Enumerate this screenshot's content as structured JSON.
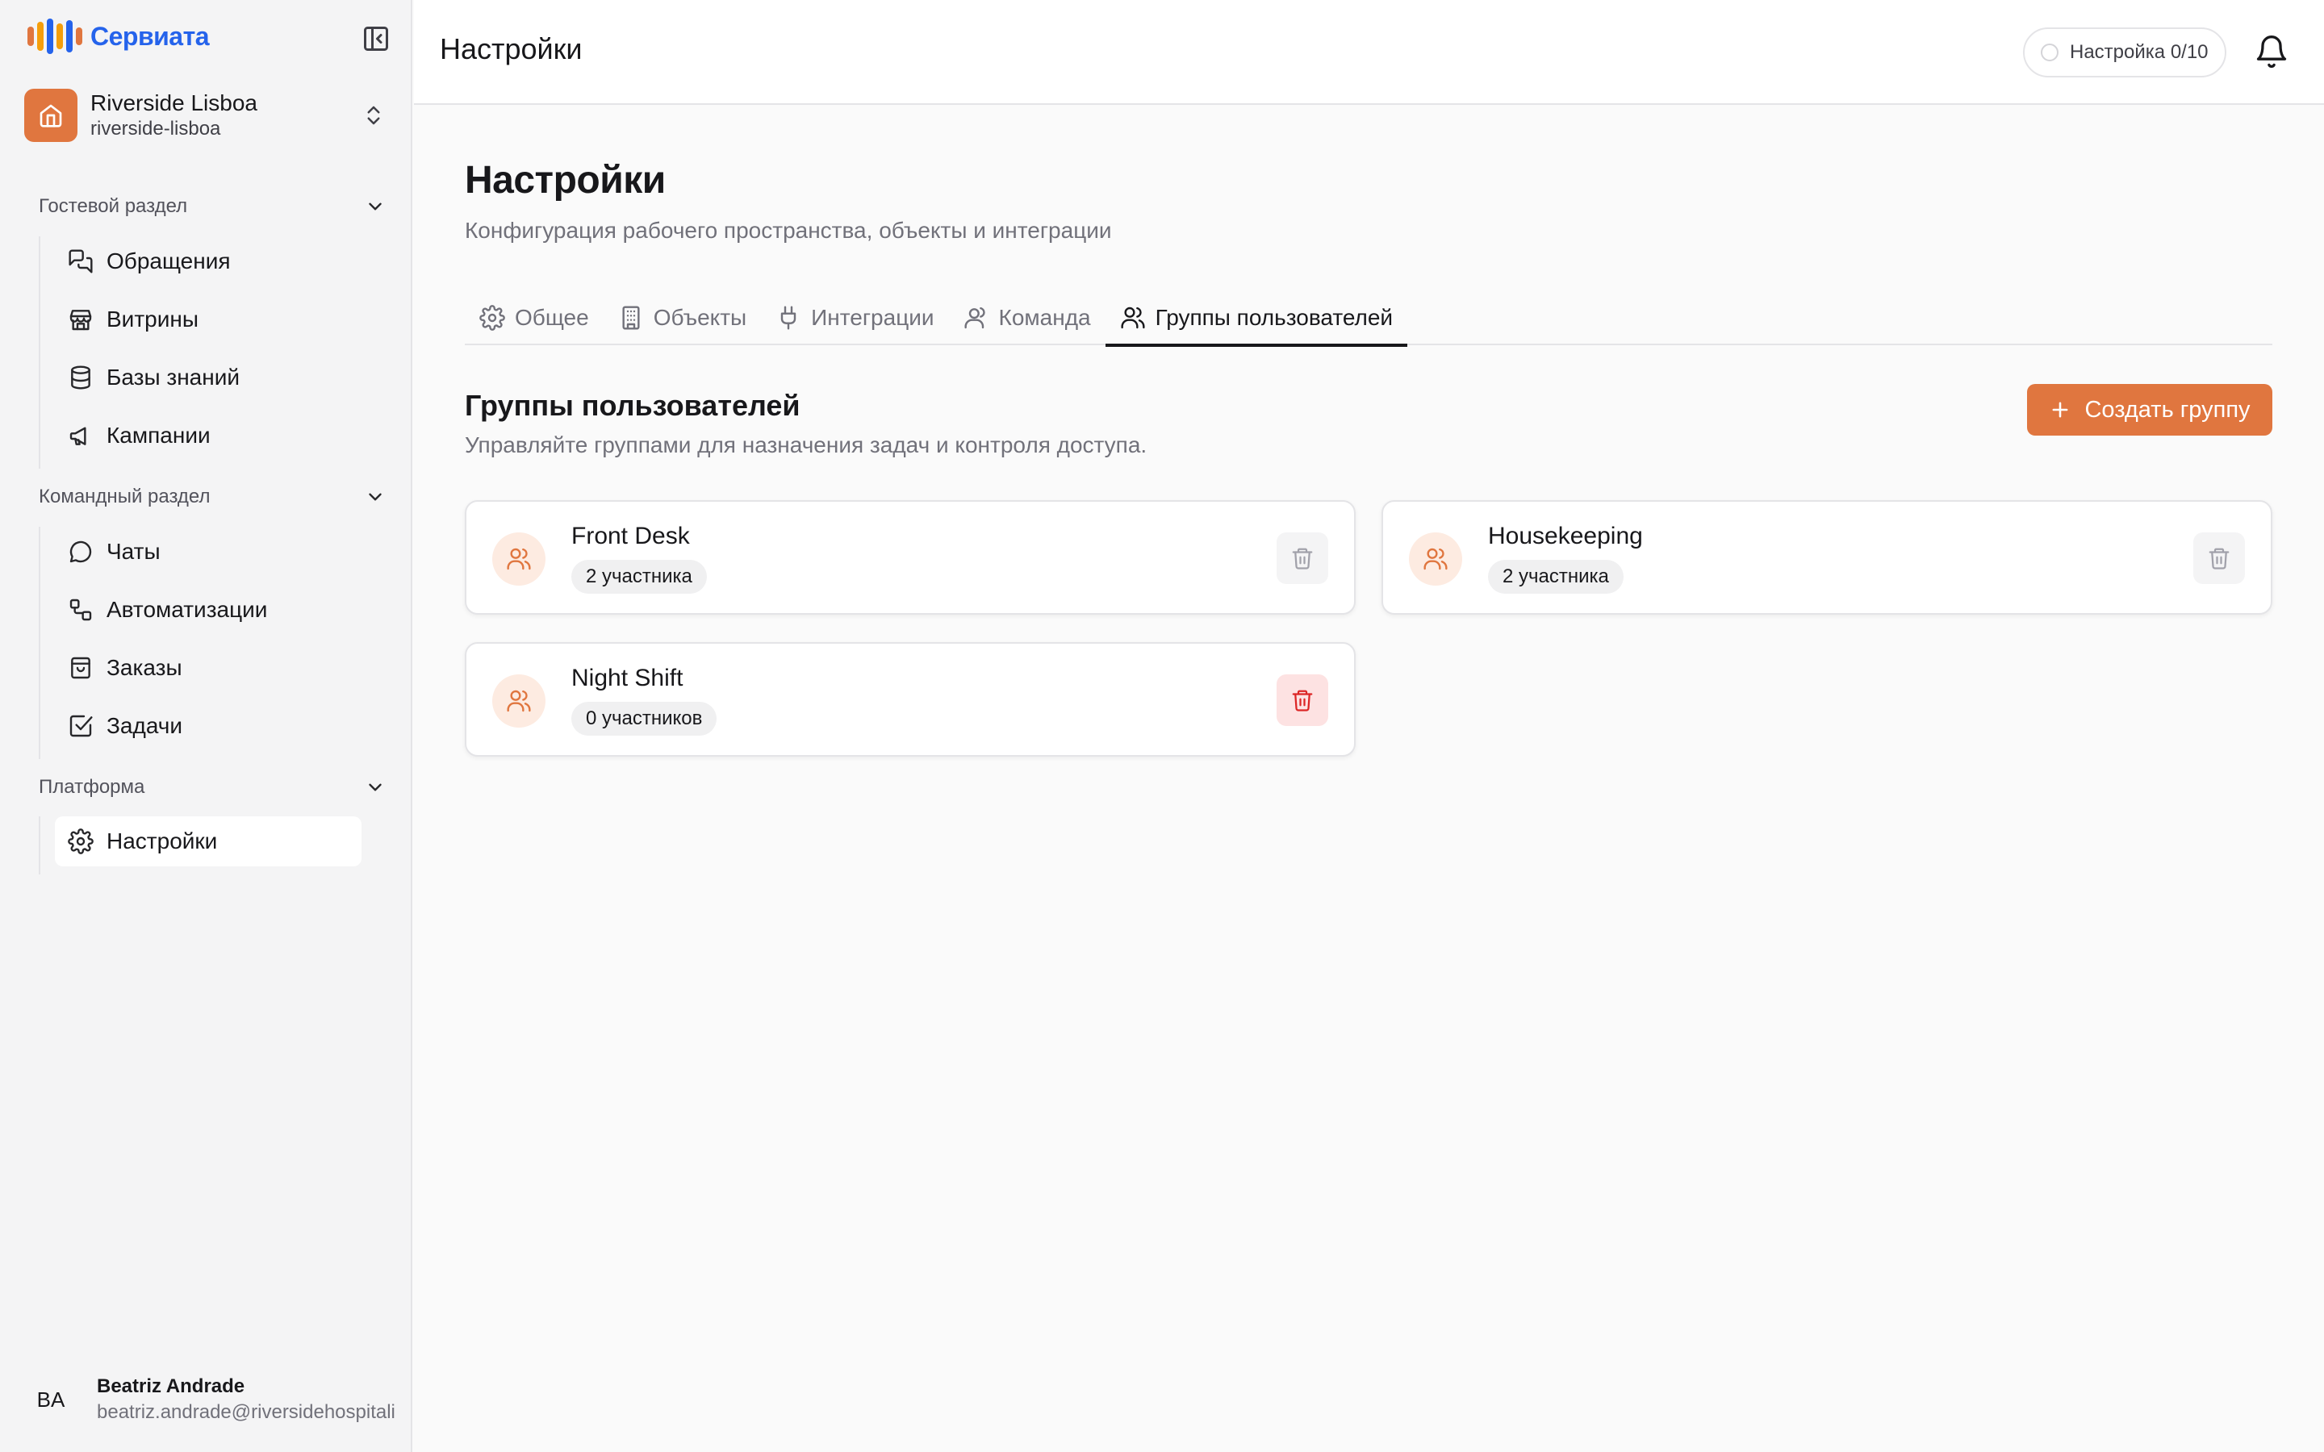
{
  "brand": {
    "name": "Сервиата",
    "bars": [
      "#e0763f",
      "#f59e0b",
      "#2563eb",
      "#f59e0b",
      "#2563eb",
      "#e0763f"
    ]
  },
  "workspace": {
    "name": "Riverside Lisboa",
    "slug": "riverside-lisboa"
  },
  "sidebar": {
    "sections": [
      {
        "title": "Гостевой раздел",
        "items": [
          {
            "label": "Обращения",
            "icon": "messages-icon"
          },
          {
            "label": "Витрины",
            "icon": "store-icon"
          },
          {
            "label": "Базы знаний",
            "icon": "database-icon"
          },
          {
            "label": "Кампании",
            "icon": "megaphone-icon"
          }
        ]
      },
      {
        "title": "Командный раздел",
        "items": [
          {
            "label": "Чаты",
            "icon": "chat-icon"
          },
          {
            "label": "Автоматизации",
            "icon": "workflow-icon"
          },
          {
            "label": "Заказы",
            "icon": "shopping-bag-icon"
          },
          {
            "label": "Задачи",
            "icon": "checkbox-icon"
          }
        ]
      },
      {
        "title": "Платформа",
        "items": [
          {
            "label": "Настройки",
            "icon": "gear-icon",
            "active": true
          }
        ]
      }
    ]
  },
  "user": {
    "initials": "BA",
    "name": "Beatriz Andrade",
    "email": "beatriz.andrade@riversidehospitality.com"
  },
  "header": {
    "title": "Настройки",
    "setup_label": "Настройка 0/10"
  },
  "page": {
    "title": "Настройки",
    "subtitle": "Конфигурация рабочего пространства, объекты и интеграции"
  },
  "tabs": [
    {
      "label": "Общее",
      "icon": "gear-icon"
    },
    {
      "label": "Объекты",
      "icon": "building-icon"
    },
    {
      "label": "Интеграции",
      "icon": "plug-icon"
    },
    {
      "label": "Команда",
      "icon": "user-icon"
    },
    {
      "label": "Группы пользователей",
      "icon": "users-icon",
      "active": true
    }
  ],
  "groups_section": {
    "title": "Группы пользователей",
    "subtitle": "Управляйте группами для назначения задач и контроля доступа.",
    "create_label": "Создать группу"
  },
  "groups": [
    {
      "name": "Front Desk",
      "members": "2 участника"
    },
    {
      "name": "Housekeeping",
      "members": "2 участника"
    },
    {
      "name": "Night Shift",
      "members": "0 участников"
    }
  ],
  "colors": {
    "accent": "#e0763f",
    "danger": "#dc2626",
    "brand_blue": "#2563eb"
  }
}
